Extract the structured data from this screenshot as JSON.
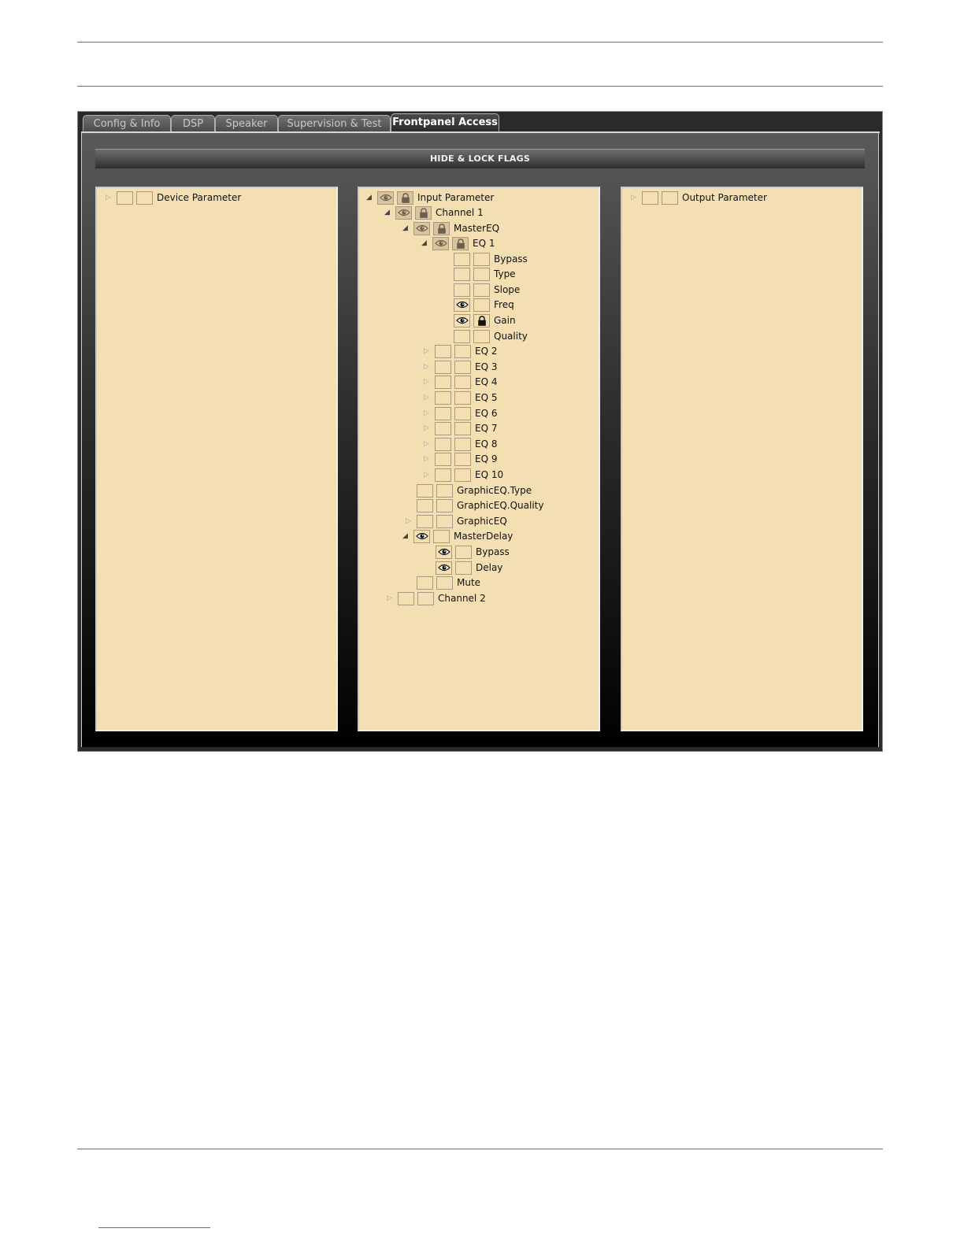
{
  "tabs": [
    {
      "label": "Config & Info",
      "active": false
    },
    {
      "label": "DSP",
      "active": false
    },
    {
      "label": "Speaker",
      "active": false
    },
    {
      "label": "Supervision & Test",
      "active": false
    },
    {
      "label": "Frontpanel Access",
      "active": true
    }
  ],
  "section_title": "HIDE & LOCK FLAGS",
  "panels": {
    "device": {
      "root_label": "Device Parameter"
    },
    "input": {
      "root_label": "Input Parameter",
      "channel_1": "Channel 1",
      "master_eq": "MasterEQ",
      "eq1": "EQ 1",
      "eq1_children": [
        "Bypass",
        "Type",
        "Slope",
        "Freq",
        "Gain",
        "Quality"
      ],
      "eq_collapsed": [
        "EQ 2",
        "EQ 3",
        "EQ 4",
        "EQ 5",
        "EQ 6",
        "EQ 7",
        "EQ 8",
        "EQ 9",
        "EQ 10"
      ],
      "graphic_eq_type": "GraphicEQ.Type",
      "graphic_eq_quality": "GraphicEQ.Quality",
      "graphic_eq": "GraphicEQ",
      "master_delay": "MasterDelay",
      "delay_children": [
        "Bypass",
        "Delay"
      ],
      "mute": "Mute",
      "channel_2": "Channel 2"
    },
    "output": {
      "root_label": "Output Parameter"
    }
  },
  "colors": {
    "panel_bg": "#f4dfb3",
    "window_bg": "#2a2a2a",
    "active_tab_text": "#ffffff"
  },
  "icons": {
    "hide_flag": "eye-icon",
    "lock_flag": "lock-icon",
    "expanded": "triangle-down-icon",
    "collapsed": "triangle-right-icon"
  }
}
